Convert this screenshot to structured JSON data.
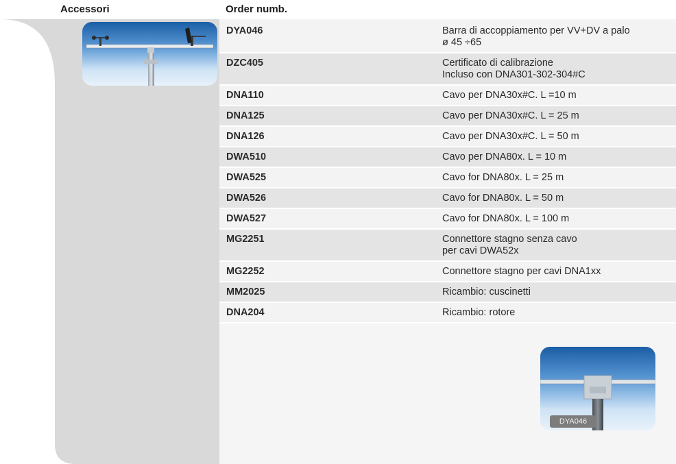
{
  "header": {
    "left": "Accessori",
    "right": "Order numb."
  },
  "rows": [
    {
      "code": "DYA046",
      "desc": "Barra di accoppiamento per VV+DV a palo\nø 45 ÷65"
    },
    {
      "code": "DZC405",
      "desc": "Certificato di calibrazione\nIncluso con DNA301-302-304#C"
    },
    {
      "code": "DNA110",
      "desc": "Cavo per DNA30x#C. L =10 m"
    },
    {
      "code": "DNA125",
      "desc": "Cavo per DNA30x#C. L = 25 m"
    },
    {
      "code": "DNA126",
      "desc": "Cavo per DNA30x#C. L = 50 m"
    },
    {
      "code": "DWA510",
      "desc": "Cavo per DNA80x. L = 10 m"
    },
    {
      "code": "DWA525",
      "desc": "Cavo for DNA80x. L = 25 m"
    },
    {
      "code": "DWA526",
      "desc": "Cavo for DNA80x. L = 50 m"
    },
    {
      "code": "DWA527",
      "desc": "Cavo for DNA80x. L = 100 m"
    },
    {
      "code": "MG2251",
      "desc": "Connettore stagno senza cavo\nper cavi DWA52x"
    },
    {
      "code": "MG2252",
      "desc": "Connettore stagno per cavi DNA1xx"
    },
    {
      "code": "MM2025",
      "desc": "Ricambio: cuscinetti"
    },
    {
      "code": "DNA204",
      "desc": "Ricambio: rotore"
    }
  ],
  "photo_caption": "DYA046",
  "colors": {
    "panel_grey": "#d9d9d9",
    "row_light": "#f3f3f3",
    "row_dark": "#e4e4e4",
    "photo_blue": "#1b5ea5"
  }
}
